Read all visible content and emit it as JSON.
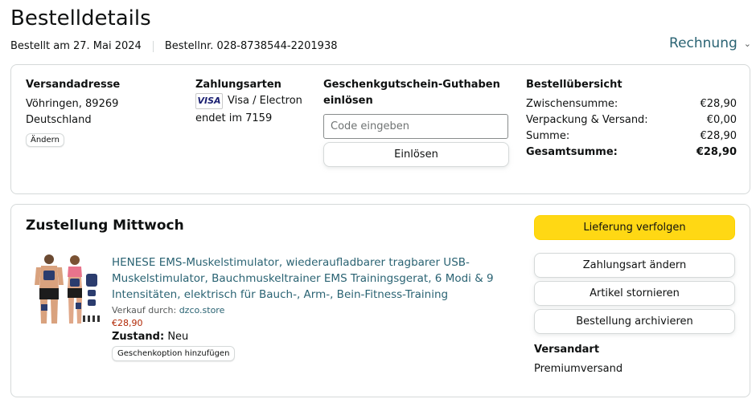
{
  "header": {
    "title": "Bestelldetails",
    "ordered_on": "Bestellt am 27. Mai 2024",
    "order_number": "Bestellnr. 028-8738544-2201938",
    "invoice_label": "Rechnung"
  },
  "shipping_address": {
    "heading": "Versandadresse",
    "line1": "Vöhringen, 89269",
    "line2": "Deutschland",
    "change_label": "Ändern"
  },
  "payment": {
    "heading": "Zahlungsarten",
    "card_brand": "VISA",
    "card_type": "Visa / Electron",
    "ending": "endet im 7159"
  },
  "gift_card": {
    "heading": "Geschenkgutschein-Guthaben einlösen",
    "placeholder": "Code eingeben",
    "redeem_label": "Einlösen"
  },
  "summary": {
    "heading": "Bestellübersicht",
    "subtotal_label": "Zwischensumme:",
    "subtotal_value": "€28,90",
    "shipping_label": "Verpackung & Versand:",
    "shipping_value": "€0,00",
    "sum_label": "Summe:",
    "sum_value": "€28,90",
    "total_label": "Gesamtsumme:",
    "total_value": "€28,90"
  },
  "delivery": {
    "title": "Zustellung Mittwoch",
    "product_title": "HENESE EMS-Muskelstimulator, wiederaufladbarer tragbarer USB-Muskelstimulator, Bauchmuskeltrainer EMS Trainingsgerat, 6 Modi & 9 Intensitäten, elektrisch für Bauch-, Arm-, Bein-Fitness-Training",
    "sold_by_label": "Verkauf durch:",
    "seller": "dzco.store",
    "price": "€28,90",
    "condition_label": "Zustand:",
    "condition_value": "Neu",
    "gift_option_label": "Geschenkoption hinzufügen"
  },
  "actions": {
    "track": "Lieferung verfolgen",
    "change_payment": "Zahlungsart ändern",
    "cancel": "Artikel stornieren",
    "archive": "Bestellung archivieren",
    "shipping_method_heading": "Versandart",
    "shipping_method_value": "Premiumversand"
  },
  "colors": {
    "link": "#2a6373",
    "price": "#b12704",
    "primary_button": "#ffd814",
    "border": "#d5d9d9"
  }
}
